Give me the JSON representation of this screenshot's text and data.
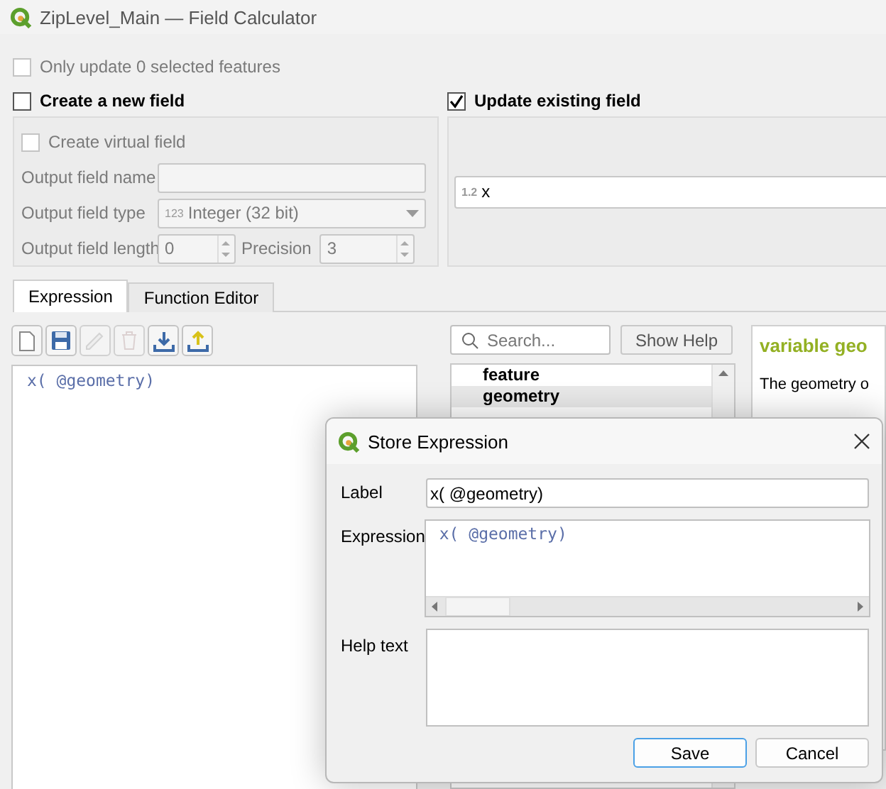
{
  "window": {
    "title": "ZipLevel_Main — Field Calculator"
  },
  "only_selected": {
    "label": "Only update 0 selected features",
    "checked": false,
    "disabled": true
  },
  "create_field": {
    "label": "Create a new field",
    "checked": false,
    "virtual": {
      "label": "Create virtual field",
      "checked": false
    },
    "name": {
      "label": "Output field name"
    },
    "type": {
      "label": "Output field type",
      "badge": "123",
      "value": "Integer (32 bit)"
    },
    "length": {
      "label": "Output field length",
      "value": "0"
    },
    "precision": {
      "label": "Precision",
      "value": "3"
    }
  },
  "update_field": {
    "label": "Update existing field",
    "checked": true,
    "field": {
      "badge": "1.2",
      "value": "x"
    }
  },
  "tabs": [
    {
      "label": "Expression",
      "selected": true
    },
    {
      "label": "Function Editor",
      "selected": false
    }
  ],
  "toolbar": [
    {
      "kind": "new",
      "disabled": false
    },
    {
      "kind": "save",
      "disabled": false
    },
    {
      "kind": "edit",
      "disabled": true
    },
    {
      "kind": "delete",
      "disabled": true
    },
    {
      "kind": "import",
      "disabled": false
    },
    {
      "kind": "export",
      "disabled": false
    }
  ],
  "expression": "x( @geometry)",
  "search": {
    "placeholder": "Search..."
  },
  "show_help": "Show Help",
  "functions": [
    {
      "label": "feature",
      "selected": false
    },
    {
      "label": "geometry",
      "selected": true
    }
  ],
  "help": {
    "title": "variable geo",
    "text": "The geometry o"
  },
  "dialog": {
    "title": "Store Expression",
    "label": {
      "label": "Label",
      "value": "x( @geometry)"
    },
    "expression": {
      "label": "Expression",
      "value": "x( @geometry)"
    },
    "help_text": {
      "label": "Help text"
    },
    "buttons": [
      {
        "label": "Save",
        "default": true
      },
      {
        "label": "Cancel",
        "default": false
      }
    ]
  }
}
